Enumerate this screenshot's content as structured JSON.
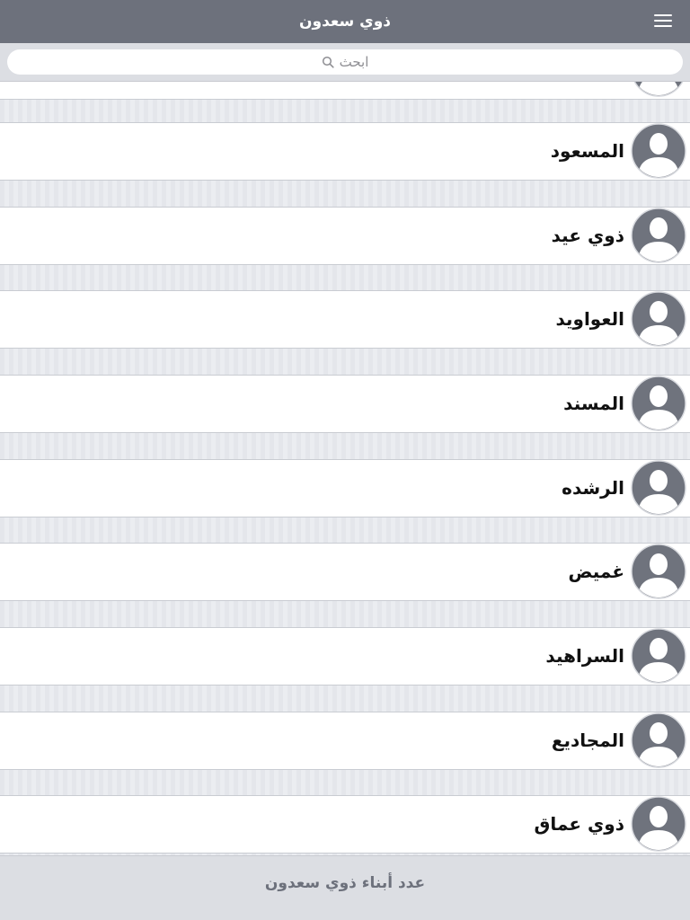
{
  "navbar": {
    "title": "ذوي سعدون",
    "menu_icon": "hamburger-menu-icon"
  },
  "search": {
    "placeholder": "ابحث",
    "icon": "search-icon"
  },
  "families": {
    "items": [
      {
        "name": "المسعود",
        "icon": "avatar-placeholder-icon"
      },
      {
        "name": "ذوي عيد",
        "icon": "avatar-placeholder-icon"
      },
      {
        "name": "العواويد",
        "icon": "avatar-placeholder-icon"
      },
      {
        "name": "المسند",
        "icon": "avatar-placeholder-icon"
      },
      {
        "name": "الرشده",
        "icon": "avatar-placeholder-icon"
      },
      {
        "name": "غميض",
        "icon": "avatar-placeholder-icon"
      },
      {
        "name": "السراهيد",
        "icon": "avatar-placeholder-icon"
      },
      {
        "name": "المجاديع",
        "icon": "avatar-placeholder-icon"
      },
      {
        "name": "ذوي عماق",
        "icon": "avatar-placeholder-icon"
      }
    ]
  },
  "footer": {
    "label": "عدد أبناء ذوي سعدون"
  },
  "colors": {
    "navbar": "#6d717c",
    "row_background": "#ffffff",
    "page_background": "#e7e9ee",
    "avatar_circle": "#6f737d",
    "text": "#111111",
    "footer_text": "#6d717c"
  }
}
